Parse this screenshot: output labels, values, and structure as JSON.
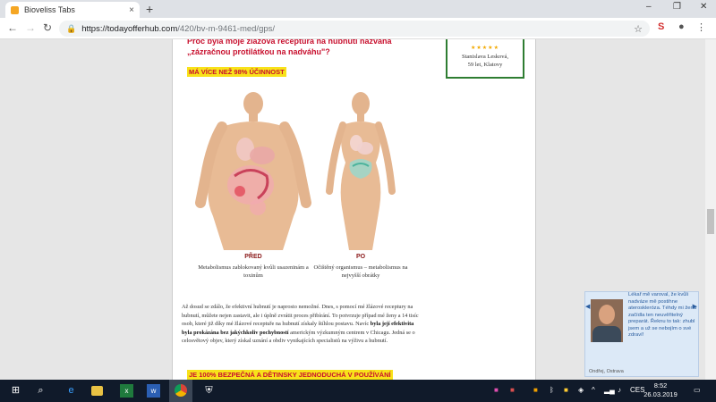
{
  "browser": {
    "tab_title": "Bioveliss Tabs",
    "tab_close": "×",
    "new_tab": "+",
    "url_host": "https://todayofferhub.com",
    "url_path": "/420/bv-m-9461-med/gps/",
    "window_controls": [
      "–",
      "❐",
      "✕"
    ]
  },
  "page": {
    "heading": "Proč byla moje žlázová receptura na hubnutí nazvána „zázračnou protilátkou na nadváhu\"?",
    "highlight1": "MÁ VÍCE NEŽ 98% ÚČINNOST",
    "review": {
      "stars": "★★★★★",
      "name": "Stanislava Lesková,",
      "meta": "59 let, Klatovy"
    },
    "before_title": "PŘED",
    "before_caption": "Metabolismus zablokovaný kvůli usazeninám a toxinům",
    "after_title": "PO",
    "after_caption": "Očištěný organismus – metabolismus na nejvyšší obrátky",
    "para_1": "Až dosud se zdálo, že efektivní hubnutí je naprosto nemožné. Dnes, s pomocí mé žlázové receptury na hubnutí, můžete nejen zastavit, ale i úplně zvrátit proces přibírání. To potvrzuje případ mé ženy a 14 tisíc osob, které již díky mé žlázové receptuře na hubnutí získaly štíhlou postavu. Navíc ",
    "para_bold": "byla její efektivita byla prokázána bez jakýchkoliv pochybností",
    "para_2": " americkým výzkumným centrem v Chicagu. Jedná se o celosvětový objev, který získal uznání a obdiv vynikajících specialistů na výživu a hubnutí.",
    "highlight2": "JE 100% BEZPEČNÁ A DĚTINSKY JEDNODUCHÁ V POUŽÍVÁNÍ"
  },
  "chat_widget": {
    "message": "Lékař mě varoval, že kvůli nadváze mě postihne ateroskleróza. Téhdy mi žena začídla ten neuvěřitelný preparát. Řeknu to tak: zhubl jsem a už se nebojím o své zdraví!",
    "author": "Ondřej, Ostrava"
  },
  "taskbar": {
    "time": "8:52",
    "date": "26.03.2019",
    "lang": "CES"
  },
  "colors": {
    "accent_red": "#c8102e",
    "highlight_yellow": "#f8e21a",
    "review_border": "#2e7d32"
  }
}
